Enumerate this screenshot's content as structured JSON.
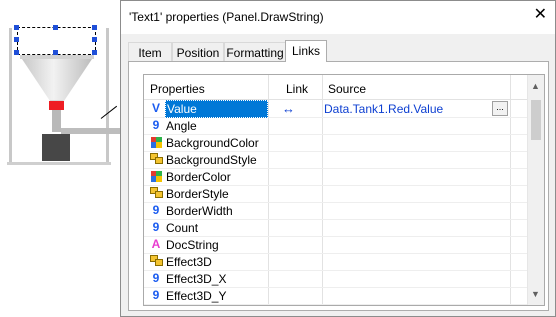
{
  "window": {
    "title": "'Text1' properties (Panel.DrawString)",
    "close_label": "✕"
  },
  "tabs": [
    {
      "label": "Item",
      "active": false
    },
    {
      "label": "Position",
      "active": false
    },
    {
      "label": "Formatting",
      "active": false
    },
    {
      "label": "Links",
      "active": true
    }
  ],
  "grid": {
    "headers": {
      "properties": "Properties",
      "link": "Link",
      "source": "Source"
    },
    "rows": [
      {
        "icon": "value-icon",
        "glyph": "V",
        "name": "Value",
        "selected": true,
        "link": "↔",
        "source": "Data.Tank1.Red.Value",
        "source_button": "..."
      },
      {
        "icon": "number-icon",
        "glyph": "9",
        "name": "Angle"
      },
      {
        "icon": "color-icon",
        "glyph": "",
        "name": "BackgroundColor"
      },
      {
        "icon": "style-icon",
        "glyph": "",
        "name": "BackgroundStyle"
      },
      {
        "icon": "color-icon",
        "glyph": "",
        "name": "BorderColor"
      },
      {
        "icon": "style-icon",
        "glyph": "",
        "name": "BorderStyle"
      },
      {
        "icon": "number-icon",
        "glyph": "9",
        "name": "BorderWidth"
      },
      {
        "icon": "number-icon",
        "glyph": "9",
        "name": "Count"
      },
      {
        "icon": "string-icon",
        "glyph": "A",
        "name": "DocString"
      },
      {
        "icon": "style-icon",
        "glyph": "",
        "name": "Effect3D"
      },
      {
        "icon": "number-icon",
        "glyph": "9",
        "name": "Effect3D_X"
      },
      {
        "icon": "number-icon",
        "glyph": "9",
        "name": "Effect3D_Y"
      }
    ]
  },
  "colors": {
    "accent": "#0078d7",
    "link_blue": "#0d3fd1",
    "tank_red": "#ee1d23"
  }
}
